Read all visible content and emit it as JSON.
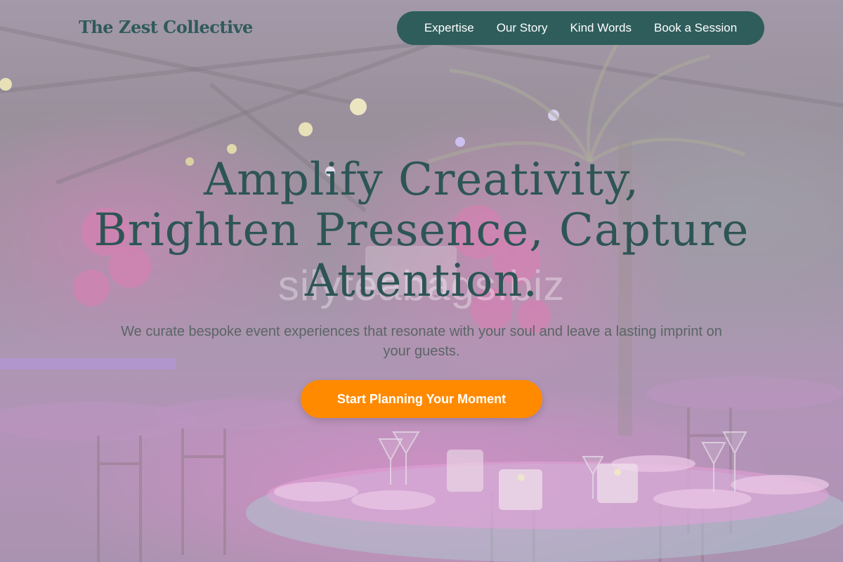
{
  "brand": {
    "name": "The Zest Collective"
  },
  "nav": {
    "items": [
      {
        "label": "Expertise"
      },
      {
        "label": "Our Story"
      },
      {
        "label": "Kind Words"
      },
      {
        "label": "Book a Session"
      }
    ]
  },
  "hero": {
    "headline_line1": "Amplify Creativity,",
    "headline_line2": "Brighten Presence, Capture",
    "headline_line3": "Attention.",
    "subheading": "We curate bespoke event experiences that resonate with your soul and leave a lasting imprint on your guests.",
    "cta_label": "Start Planning Your Moment",
    "watermark": "silyteabags.biz"
  },
  "colors": {
    "brand_teal": "#2f5d5c",
    "cta_orange": "#ff8a00",
    "headline": "#2e5556"
  }
}
